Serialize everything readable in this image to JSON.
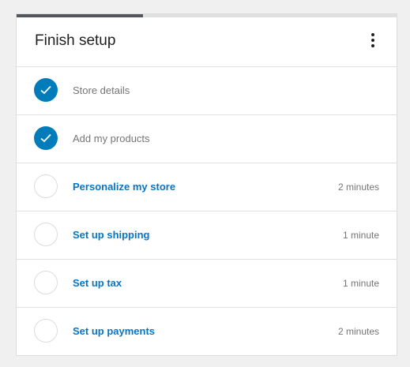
{
  "setup": {
    "title": "Finish setup",
    "progress_fraction": 0.333,
    "colors": {
      "accent": "#007cba",
      "link": "#0675c4",
      "muted_text": "#757575",
      "progress_fill": "#50575e"
    },
    "menu_icon": "more-vertical-icon",
    "tasks": [
      {
        "label": "Store details",
        "time": "",
        "completed": true
      },
      {
        "label": "Add my products",
        "time": "",
        "completed": true
      },
      {
        "label": "Personalize my store",
        "time": "2 minutes",
        "completed": false
      },
      {
        "label": "Set up shipping",
        "time": "1 minute",
        "completed": false
      },
      {
        "label": "Set up tax",
        "time": "1 minute",
        "completed": false
      },
      {
        "label": "Set up payments",
        "time": "2 minutes",
        "completed": false
      }
    ]
  }
}
